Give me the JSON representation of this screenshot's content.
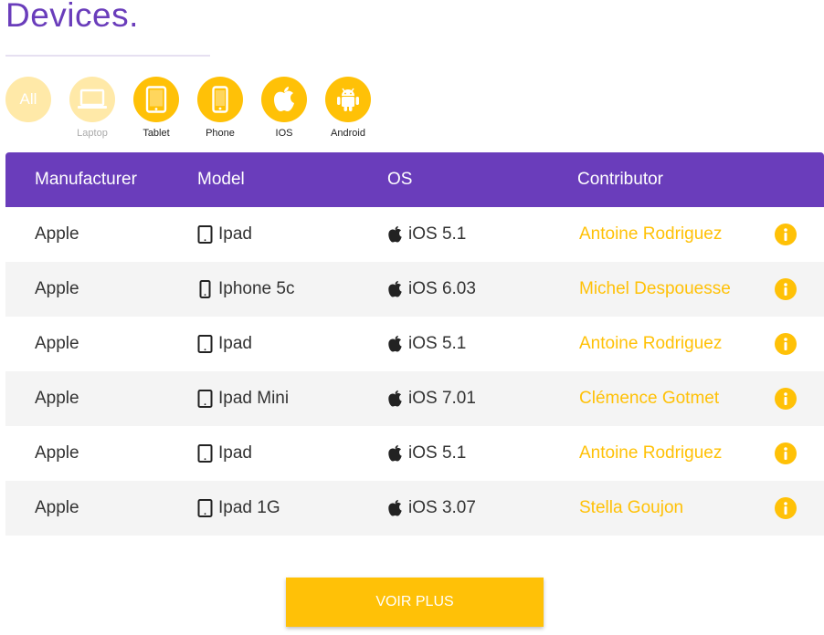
{
  "page": {
    "title": "Devices."
  },
  "filters": [
    {
      "label": "All",
      "icon": "all-text",
      "active": false
    },
    {
      "label": "Laptop",
      "icon": "laptop-icon",
      "active": false
    },
    {
      "label": "Tablet",
      "icon": "tablet-icon",
      "active": true
    },
    {
      "label": "Phone",
      "icon": "phone-icon",
      "active": true
    },
    {
      "label": "IOS",
      "icon": "apple-icon",
      "active": true
    },
    {
      "label": "Android",
      "icon": "android-icon",
      "active": true
    }
  ],
  "table": {
    "headers": [
      "Manufacturer",
      "Model",
      "OS",
      "Contributor"
    ],
    "rows": [
      {
        "manufacturer": "Apple",
        "model": "Ipad",
        "model_icon": "tablet-icon",
        "os": "iOS 5.1",
        "contributor": "Antoine Rodriguez"
      },
      {
        "manufacturer": "Apple",
        "model": "Iphone 5c",
        "model_icon": "phone-icon",
        "os": "iOS 6.03",
        "contributor": "Michel Despouesse"
      },
      {
        "manufacturer": "Apple",
        "model": "Ipad",
        "model_icon": "tablet-icon",
        "os": "iOS 5.1",
        "contributor": "Antoine Rodriguez"
      },
      {
        "manufacturer": "Apple",
        "model": "Ipad Mini",
        "model_icon": "tablet-icon",
        "os": "iOS 7.01",
        "contributor": "Clémence Gotmet"
      },
      {
        "manufacturer": "Apple",
        "model": "Ipad",
        "model_icon": "tablet-icon",
        "os": "iOS 5.1",
        "contributor": "Antoine Rodriguez"
      },
      {
        "manufacturer": "Apple",
        "model": "Ipad 1G",
        "model_icon": "tablet-icon",
        "os": "iOS 3.07",
        "contributor": "Stella Goujon"
      }
    ]
  },
  "more_button": {
    "label": "VOIR PLUS"
  },
  "colors": {
    "accent": "#6a3dbb",
    "yellow": "#ffc107",
    "yellow_dim": "#ffe9a8",
    "row_alt": "#f4f4f4"
  }
}
